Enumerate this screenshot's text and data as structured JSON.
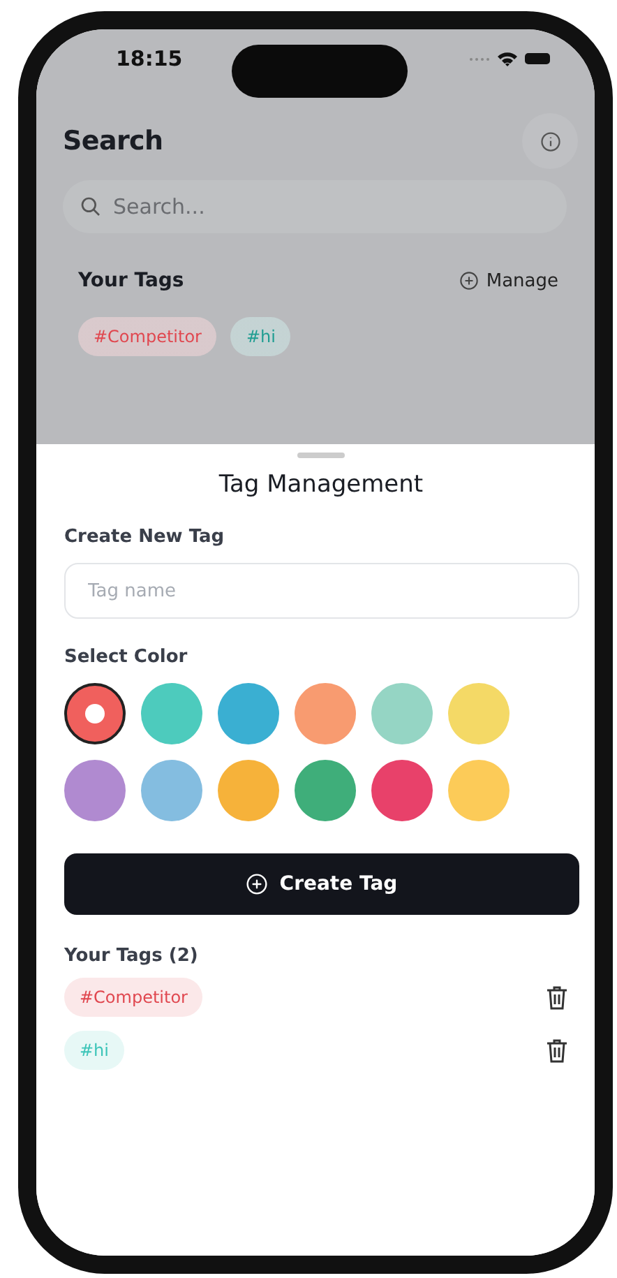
{
  "status_bar": {
    "time": "18:15"
  },
  "header": {
    "title": "Search"
  },
  "search": {
    "placeholder": "Search..."
  },
  "tags_section": {
    "title": "Your Tags",
    "manage_label": "Manage",
    "tags": [
      {
        "label": "#Competitor",
        "color": "#e0474f"
      },
      {
        "label": "#hi",
        "color": "#1f9d91"
      }
    ]
  },
  "sheet": {
    "title": "Tag Management",
    "create_label": "Create New Tag",
    "name_field": {
      "placeholder": "Tag name"
    },
    "color_label": "Select Color",
    "colors": [
      {
        "color": "#f0605d",
        "selected": true
      },
      {
        "color": "#4dcbbd",
        "selected": false
      },
      {
        "color": "#3aafd2",
        "selected": false
      },
      {
        "color": "#f89b70",
        "selected": false
      },
      {
        "color": "#95d5c4",
        "selected": false
      },
      {
        "color": "#f4d966",
        "selected": false
      },
      {
        "color": "#b08ad0",
        "selected": false
      },
      {
        "color": "#84bde0",
        "selected": false
      },
      {
        "color": "#f6b23a",
        "selected": false
      },
      {
        "color": "#3fae7a",
        "selected": false
      },
      {
        "color": "#e8416a",
        "selected": false
      },
      {
        "color": "#fccb58",
        "selected": false
      }
    ],
    "create_button": "Create Tag",
    "list_title": "Your Tags (2)",
    "tags": [
      {
        "label": "#Competitor",
        "color": "#e0474f"
      },
      {
        "label": "#hi",
        "color": "#3cc4b8"
      }
    ]
  }
}
